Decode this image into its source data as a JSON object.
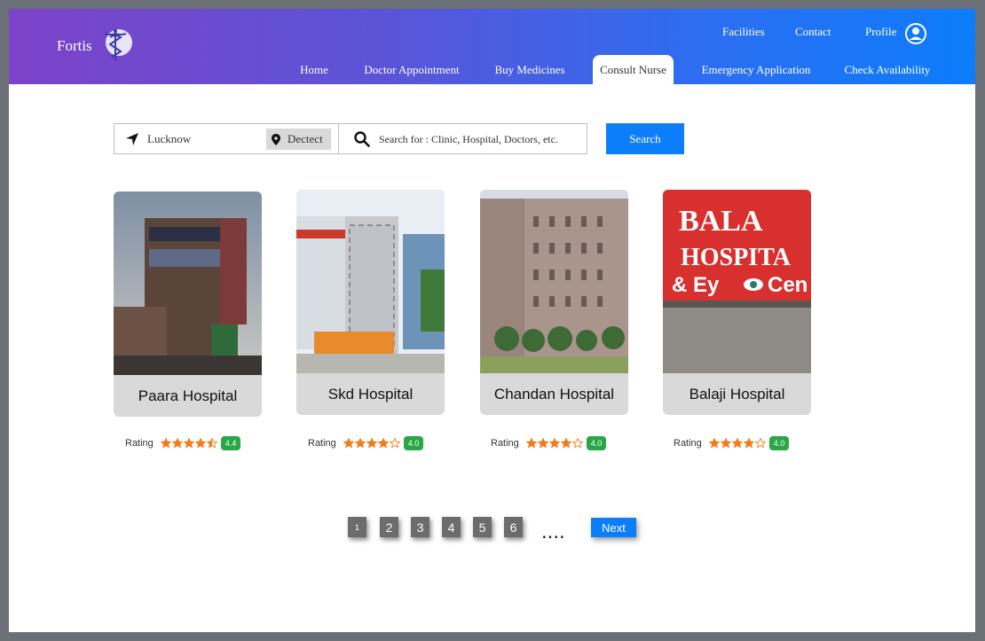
{
  "brand": {
    "name": "Fortis"
  },
  "top_links": {
    "facilities": "Facilities",
    "contact": "Contact",
    "profile": "Profile"
  },
  "nav": [
    "Home",
    "Doctor Appointment",
    "Buy Medicines",
    "Consult Nurse",
    "Emergency Application",
    "Check Availability"
  ],
  "nav_active": "Consult Nurse",
  "search": {
    "location": "Lucknow",
    "detect_label": "Dectect",
    "placeholder": "Search for : Clinic, Hospital, Doctors, etc.",
    "button_label": "Search"
  },
  "rating_label": "Rating",
  "hospitals": [
    {
      "name": "Paara Hospital",
      "rating": "4.4",
      "stars": 4.5
    },
    {
      "name": "Skd Hospital",
      "rating": "4.0",
      "stars": 4
    },
    {
      "name": "Chandan Hospital",
      "rating": "4.0",
      "stars": 4
    },
    {
      "name": "Balaji Hospital",
      "rating": "4.0",
      "stars": 4
    }
  ],
  "sign_text": {
    "line1": "BALA",
    "line2": "HOSPITA",
    "line3": "& Ey",
    "line4": "Cen"
  },
  "pagination": {
    "pages": [
      "1",
      "2",
      "3",
      "4",
      "5",
      "6"
    ],
    "current": "1",
    "ellipsis": "....",
    "next": "Next"
  },
  "colors": {
    "header_start": "#7d42c8",
    "header_end": "#0c7dfb",
    "accent": "#0c7dfb",
    "star": "#f07c1a",
    "badge": "#28a745"
  }
}
